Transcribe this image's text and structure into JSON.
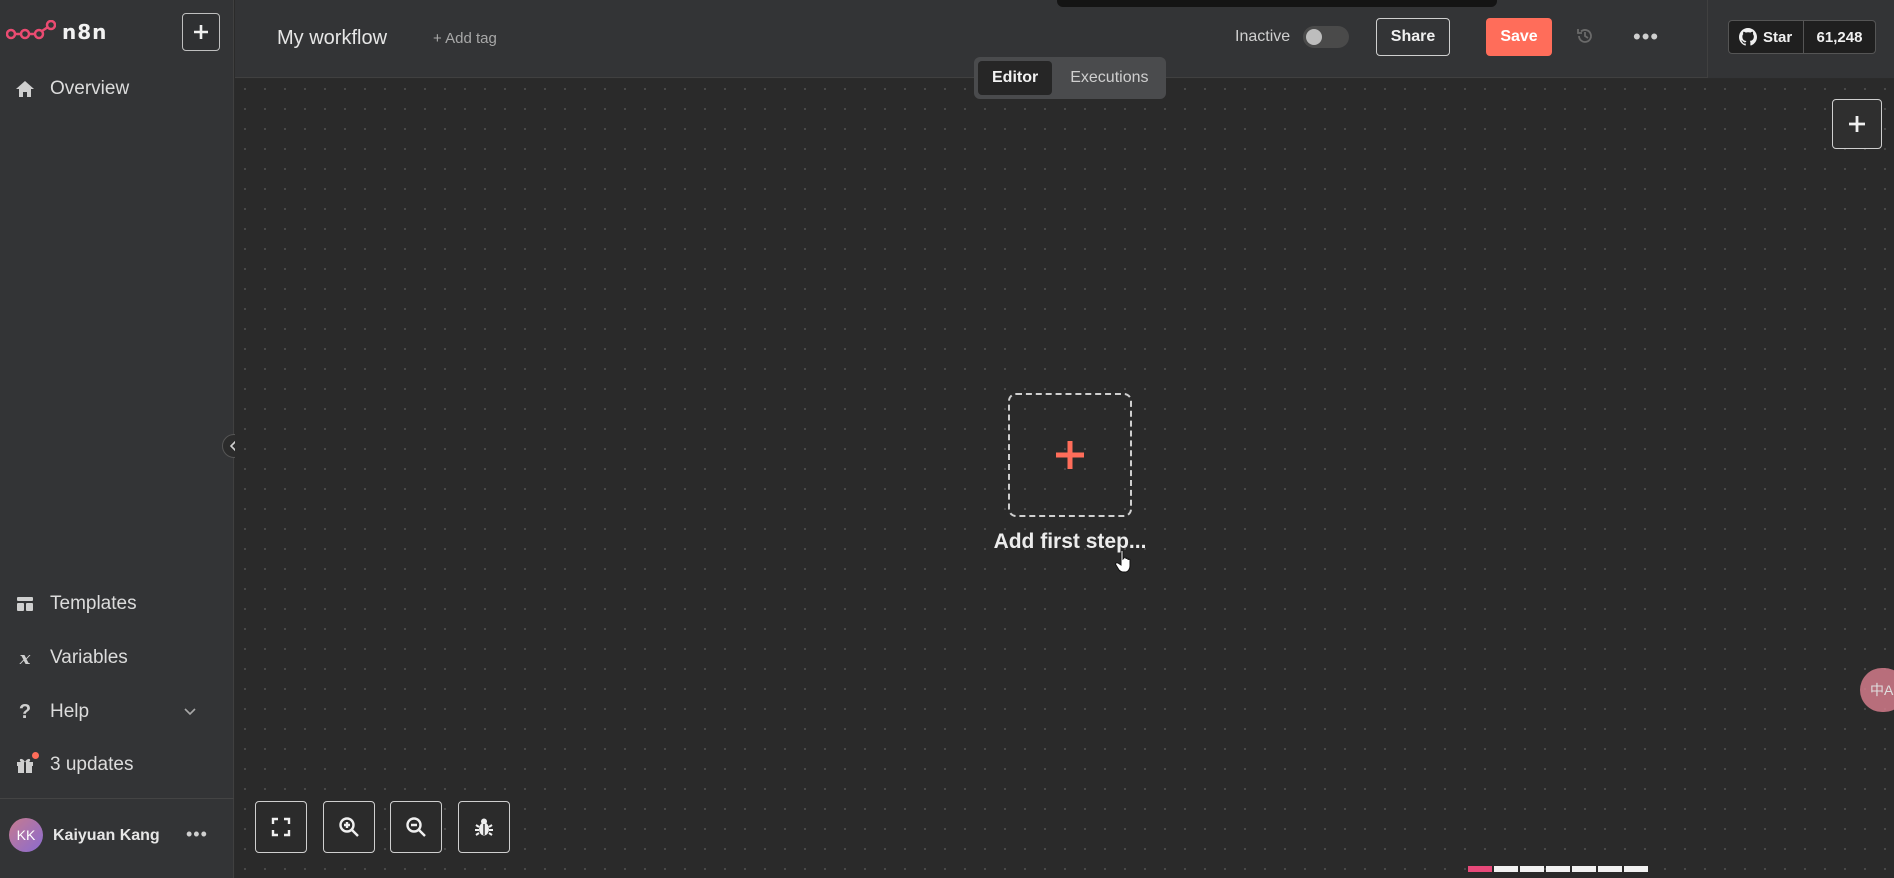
{
  "sidebar": {
    "brand": "n8n",
    "new_button_icon": "plus-icon",
    "items": [
      {
        "label": "Overview",
        "icon": "home-icon"
      },
      {
        "label": "Templates",
        "icon": "templates-icon"
      },
      {
        "label": "Variables",
        "icon": "variables-icon"
      },
      {
        "label": "Help",
        "icon": "help-icon"
      },
      {
        "label": "3 updates",
        "icon": "gift-icon"
      }
    ],
    "user": {
      "initials": "KK",
      "name": "Kaiyuan Kang",
      "more": "•••"
    }
  },
  "header": {
    "workflow_name": "My workflow",
    "add_tag": "+ Add tag",
    "status_label": "Inactive",
    "active": false,
    "share_label": "Share",
    "save_label": "Save",
    "more_label": "•••",
    "github": {
      "star_label": "Star",
      "count": "61,248"
    }
  },
  "tabs": [
    {
      "label": "Editor",
      "active": true
    },
    {
      "label": "Executions",
      "active": false
    }
  ],
  "canvas": {
    "add_first_step": "Add first step...",
    "controls": [
      "fit-view-icon",
      "zoom-in-icon",
      "zoom-out-icon",
      "debug-icon"
    ],
    "translate_bubble": "中A"
  },
  "colors": {
    "accent": "#ff6d5a",
    "sidebar_bg": "#333436",
    "canvas_bg": "#2a2a2a"
  }
}
